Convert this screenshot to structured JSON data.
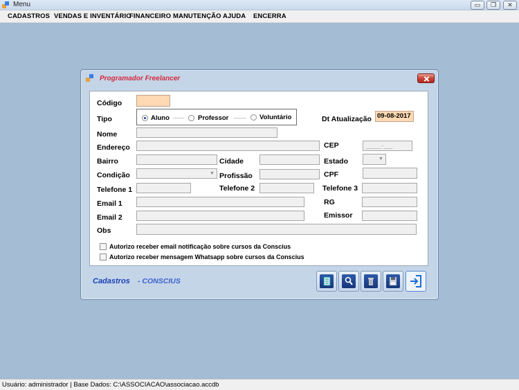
{
  "window": {
    "title": "Menu"
  },
  "menu": [
    "CADASTROS",
    "VENDAS E INVENTÁRIO",
    "FINANCEIRO",
    "MANUTENÇÃO",
    "AJUDA",
    "ENCERRA"
  ],
  "dialog": {
    "title": "Programador Freelancer",
    "labels": {
      "codigo": "Código",
      "tipo": "Tipo",
      "dt_atualizacao": "Dt Atualização",
      "nome": "Nome",
      "endereco": "Endereço",
      "cep": "CEP",
      "bairro": "Bairro",
      "cidade": "Cidade",
      "estado": "Estado",
      "condicao": "Condição",
      "profissao": "Profissão",
      "cpf": "CPF",
      "telefone1": "Telefone 1",
      "telefone2": "Telefone 2",
      "telefone3": "Telefone 3",
      "email1": "Email 1",
      "rg": "RG",
      "email2": "Email 2",
      "emissor": "Emissor",
      "obs": "Obs"
    },
    "tipo_options": [
      {
        "label": "Aluno",
        "checked": true
      },
      {
        "label": "Professor",
        "checked": false
      },
      {
        "label": "Voluntário",
        "checked": false
      }
    ],
    "dt_atualizacao_value": "09-08-2017",
    "cep_mask": "_____-___",
    "checkboxes": [
      "Autorizo receber email notificação sobre cursos da Conscius",
      "Autorizo receber mensagem Whatsapp sobre cursos da Conscius"
    ],
    "footer": {
      "cadastros": "Cadastros",
      "conscius": "- CONSCIUS"
    },
    "toolbar_icons": [
      "new-document-icon",
      "search-icon",
      "trash-icon",
      "save-icon",
      "exit-icon"
    ],
    "accent_color": "#1a3eb8",
    "title_color": "#d42a3e"
  },
  "status": "Usuário: administrador | Base Dados: C:\\ASSOCIACAO\\associacao.accdb"
}
